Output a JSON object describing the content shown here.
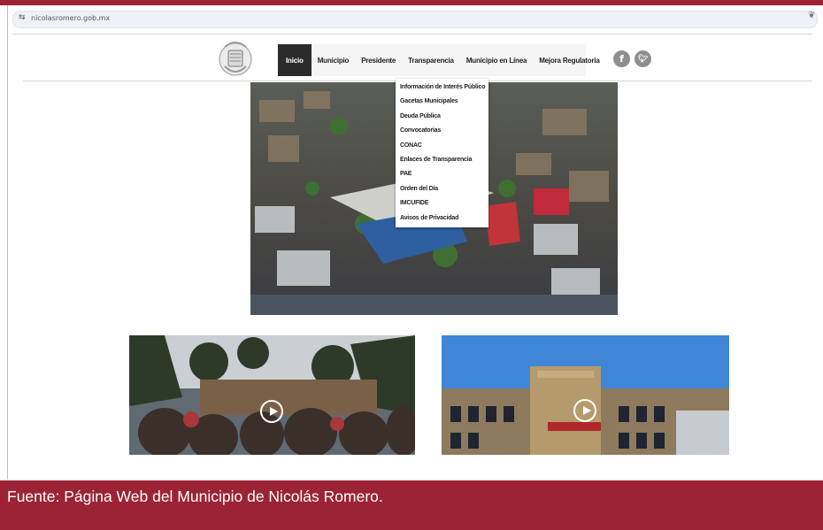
{
  "browser": {
    "url": "nicolasromero.gob.mx"
  },
  "nav": {
    "items": [
      "Inicio",
      "Municipio",
      "Presidente",
      "Transparencia",
      "Municipio en Línea",
      "Mejora Regulatoria"
    ],
    "active": "Inicio"
  },
  "social": {
    "facebook_icon": "facebook-icon",
    "twitter_icon": "twitter-icon"
  },
  "dropdown": {
    "parent": "Transparencia",
    "items": [
      "Información de Interés Público",
      "Gacetas Municipales",
      "Deuda Pública",
      "Convocatorias",
      "CONAC",
      "Enlaces de Transparencia",
      "PAE",
      "Orden del Día",
      "IMCUFIDE",
      "Avisos de Privacidad"
    ]
  },
  "videos": [
    {
      "icon": "play-icon"
    },
    {
      "icon": "play-icon"
    }
  ],
  "caption": {
    "text": "Fuente: Página Web del Municipio de Nicolás Romero."
  },
  "colors": {
    "caption_band": "#9b2335",
    "nav_active": "#2b2b2b",
    "social_icon": "#8e8e8e"
  }
}
